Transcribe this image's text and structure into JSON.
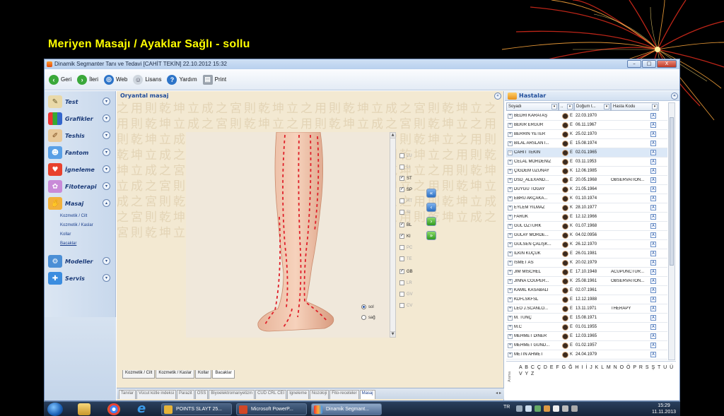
{
  "slide_title": "Meriyen Masajı / Ayaklar  Sağlı - sollu",
  "window": {
    "title": "Dinamik Segmanter Tanı ve Tedavi [CAHİT TEKİN] 22.10.2012 15:32",
    "controls": {
      "minimize": "–",
      "maximize": "□",
      "close": "X"
    }
  },
  "toolbar": {
    "back": "Geri",
    "forward": "İleri",
    "web": "Web",
    "license": "Lisans",
    "help": "Yardım",
    "print": "Print"
  },
  "sidebar": {
    "items": [
      {
        "label": "Test",
        "icon": "notepad-icon"
      },
      {
        "label": "Grafikler",
        "icon": "bar-chart-icon"
      },
      {
        "label": "Teshis",
        "icon": "pen-icon"
      },
      {
        "label": "Fantom",
        "icon": "person-icon"
      },
      {
        "label": "İgneleme",
        "icon": "heart-icon"
      },
      {
        "label": "Fitoterapi",
        "icon": "flower-icon"
      },
      {
        "label": "Masaj",
        "icon": "hand-icon"
      },
      {
        "label": "Modeller",
        "icon": "gear-icon"
      },
      {
        "label": "Servis",
        "icon": "wrench-icon"
      }
    ],
    "masaj_subitems": [
      "Kozmetik / Cilt",
      "Kozmetik / Kaslar",
      "Kollar",
      "Bacaklar"
    ]
  },
  "center": {
    "header": "Oryantal masaj",
    "meridians": [
      {
        "code": "LU",
        "checked": false
      },
      {
        "code": "LI",
        "checked": false
      },
      {
        "code": "ST",
        "checked": true
      },
      {
        "code": "SP",
        "checked": true
      },
      {
        "code": "HT",
        "checked": false
      },
      {
        "code": "SI",
        "checked": false
      },
      {
        "code": "BL",
        "checked": true
      },
      {
        "code": "KI",
        "checked": true
      },
      {
        "code": "PC",
        "checked": false
      },
      {
        "code": "TE",
        "checked": false
      },
      {
        "code": "GB",
        "checked": true
      },
      {
        "code": "LR",
        "checked": false
      },
      {
        "code": "GV",
        "checked": false
      },
      {
        "code": "CV",
        "checked": false
      }
    ],
    "side_options": [
      {
        "label": "sol",
        "selected": true
      },
      {
        "label": "sağ",
        "selected": false
      }
    ],
    "sub_tabs": [
      "Kozmetik / Cilt",
      "Kozmetik / Kaslar",
      "Kollar",
      "Bacaklar"
    ],
    "active_sub_tab": "Bacaklar",
    "main_tabs": [
      "Tanılar",
      "Vücut kütle indeksi",
      "Parazit",
      "OSS",
      "Biyoelektromanyetizm",
      "CUD CRL CEI",
      "Igneleme",
      "Nozoloji",
      "Fito-receteler",
      "Masaj"
    ],
    "active_main_tab": "Masaj"
  },
  "patients": {
    "header": "Hastalar",
    "columns": [
      "Soyadı",
      "..",
      "Doğum t...",
      "Hasta Kodu"
    ],
    "rows": [
      {
        "name": "BEDRİ KARATAŞ",
        "sex": "E",
        "birth": "22.03.1970",
        "code": ""
      },
      {
        "name": "BEKİR ERGÜR",
        "sex": "E",
        "birth": "06.11.1967",
        "code": ""
      },
      {
        "name": "BERRİN YETER",
        "sex": "K",
        "birth": "25.02.1970",
        "code": ""
      },
      {
        "name": "BİLAL ARSLANT...",
        "sex": "E",
        "birth": "15.08.1974",
        "code": ""
      },
      {
        "name": "CAHİT TEKİN",
        "sex": "E",
        "birth": "02.01.1965",
        "code": ""
      },
      {
        "name": "CELAL MORDENİZ",
        "sex": "E",
        "birth": "03.11.1953",
        "code": ""
      },
      {
        "name": "ÇİĞDEM UZUNAY",
        "sex": "K",
        "birth": "12.06.1985",
        "code": ""
      },
      {
        "name": "DSD_ALEXAND...",
        "sex": "E",
        "birth": "20.05.1968",
        "code": "OBSERVATION..."
      },
      {
        "name": "DUYGU TOGAY",
        "sex": "K",
        "birth": "21.05.1964",
        "code": ""
      },
      {
        "name": "EBRU AKÇAKA...",
        "sex": "K",
        "birth": "01.10.1974",
        "code": ""
      },
      {
        "name": "EYLEM YILMAZ",
        "sex": "K",
        "birth": "28.10.1977",
        "code": ""
      },
      {
        "name": "FARUK",
        "sex": "E",
        "birth": "12.12.1966",
        "code": ""
      },
      {
        "name": "GÜL ÖZTÜRK",
        "sex": "K",
        "birth": "01.07.1968",
        "code": ""
      },
      {
        "name": "GÜLAY MORDE...",
        "sex": "K",
        "birth": "04.02.0956",
        "code": ""
      },
      {
        "name": "GÜLSEN ÇALIŞK...",
        "sex": "K",
        "birth": "26.12.1970",
        "code": ""
      },
      {
        "name": "İLKIN KÜÇÜK",
        "sex": "E",
        "birth": "26.01.1981",
        "code": ""
      },
      {
        "name": "İSMET AS",
        "sex": "K",
        "birth": "20.02.1979",
        "code": ""
      },
      {
        "name": "JIM MISCHEL",
        "sex": "E",
        "birth": "17.10.1948",
        "code": "ACUPUNCTUR..."
      },
      {
        "name": "JINNA COUPER...",
        "sex": "K",
        "birth": "25.08.1961",
        "code": "OBSERVATION..."
      },
      {
        "name": "KÂMİL KASABALI",
        "sex": "E",
        "birth": "02.07.1961",
        "code": ""
      },
      {
        "name": "KDFLSKFSL",
        "sex": "E",
        "birth": "12.12.1988",
        "code": ""
      },
      {
        "name": "LEO J.SCANLO...",
        "sex": "E",
        "birth": "13.11.1971",
        "code": "THERAPY"
      },
      {
        "name": "M. TUNÇ",
        "sex": "E",
        "birth": "15.08.1971",
        "code": ""
      },
      {
        "name": "M.C",
        "sex": "E",
        "birth": "01.01.1955",
        "code": ""
      },
      {
        "name": "MEHMET DİNER",
        "sex": "E",
        "birth": "12.03.1965",
        "code": ""
      },
      {
        "name": "MEHMET GÜND...",
        "sex": "E",
        "birth": "01.02.1957",
        "code": ""
      },
      {
        "name": "METİN AHMET",
        "sex": "K",
        "birth": "24.04.1979",
        "code": ""
      }
    ],
    "selected_index": 4,
    "alphabet_label": "Arama",
    "alphabet": "A B C Ç D E F G Ğ H I İ J K L M N O Ö P R S Ş T U Ü V Y Z"
  },
  "taskbar": {
    "buttons": [
      "POINTS SLAYT 25...",
      "Microsoft PowerP...",
      "Dinamik Segmant..."
    ],
    "language": "TR",
    "time": "15:29",
    "date": "11.11.2013"
  },
  "colors": {
    "title_yellow": "#ffff00",
    "meridian_line": "#e0202a",
    "accent_blue": "#1f4d9a",
    "panel_beige": "#f3e9d2"
  }
}
